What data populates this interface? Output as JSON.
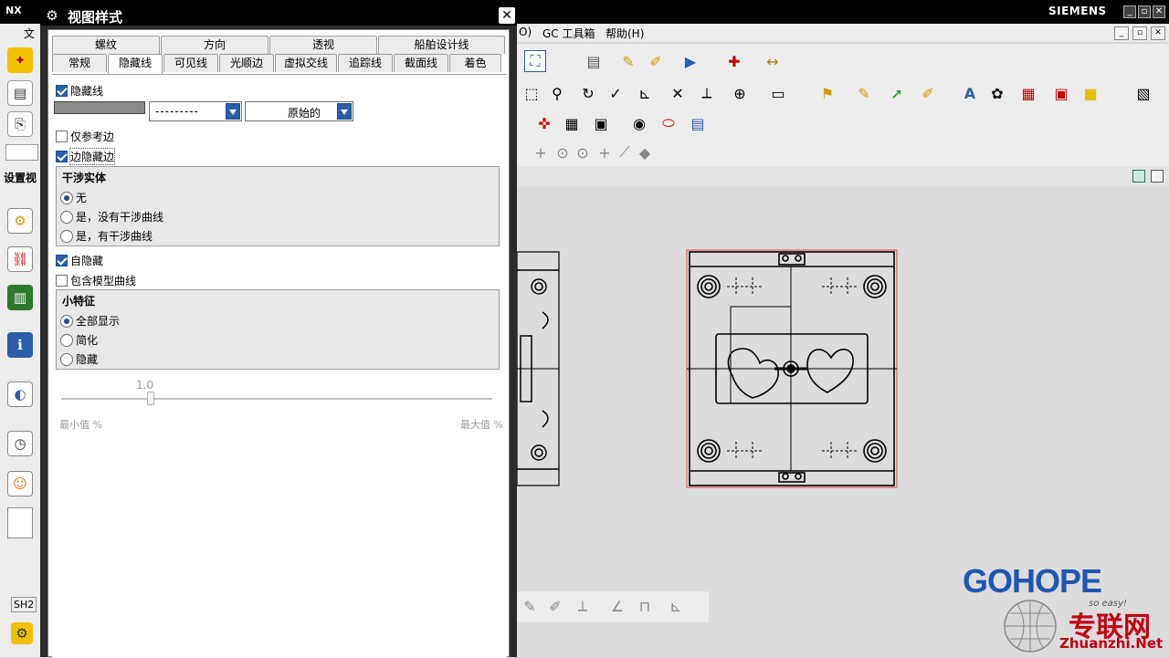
{
  "app": {
    "brand": "NX",
    "vendor": "SIEMENS",
    "left_labels": {
      "file_char": "文",
      "setup_view": "设置视",
      "sh2": "SH2"
    },
    "menu": [
      {
        "id": "menu-o",
        "label": "O)"
      },
      {
        "id": "menu-gc",
        "label": "GC 工具箱"
      },
      {
        "id": "menu-help",
        "label": "帮助(H)"
      }
    ]
  },
  "dialog": {
    "title": "视图样式",
    "close_glyph": "✕",
    "tabs_row1": [
      "螺纹",
      "方向",
      "透视",
      "船舶设计线"
    ],
    "tabs_row2": [
      "常规",
      "隐藏线",
      "可见线",
      "光顺边",
      "虚拟交线",
      "追踪线",
      "截面线",
      "着色"
    ],
    "active_tab": "隐藏线",
    "hidden_lines": {
      "checkbox_label": "隐藏线",
      "checked": true,
      "color": "#8a8a8a",
      "line_style_value": "---------",
      "width_value": "原始的"
    },
    "reference_edges_only": {
      "label": "仅参考边",
      "checked": false
    },
    "edges_hidden_by_edges": {
      "label": "边隐藏边",
      "checked": true
    },
    "interfering_solids": {
      "title": "干涉实体",
      "options": [
        "无",
        "是，没有干涉曲线",
        "是，有干涉曲线"
      ],
      "selected_index": 0
    },
    "self_hidden": {
      "label": "自隐藏",
      "checked": true
    },
    "include_model_curves": {
      "label": "包含模型曲线",
      "checked": false
    },
    "small_features": {
      "title": "小特征",
      "options": [
        "全部显示",
        "简化",
        "隐藏"
      ],
      "selected_index": 0
    },
    "slider": {
      "value_label": "1.0",
      "value": 1.0,
      "min_label": "最小值 %",
      "max_label": "最大值 %"
    }
  },
  "watermark": {
    "brand": "GOHOPE",
    "slogan": "so easy!",
    "cn": "专联网",
    "url": "Zhuanzhi.Net"
  },
  "colors": {
    "accent": "#2b5ea8",
    "title_bar": "#000000",
    "selection_border": "#e06060"
  }
}
